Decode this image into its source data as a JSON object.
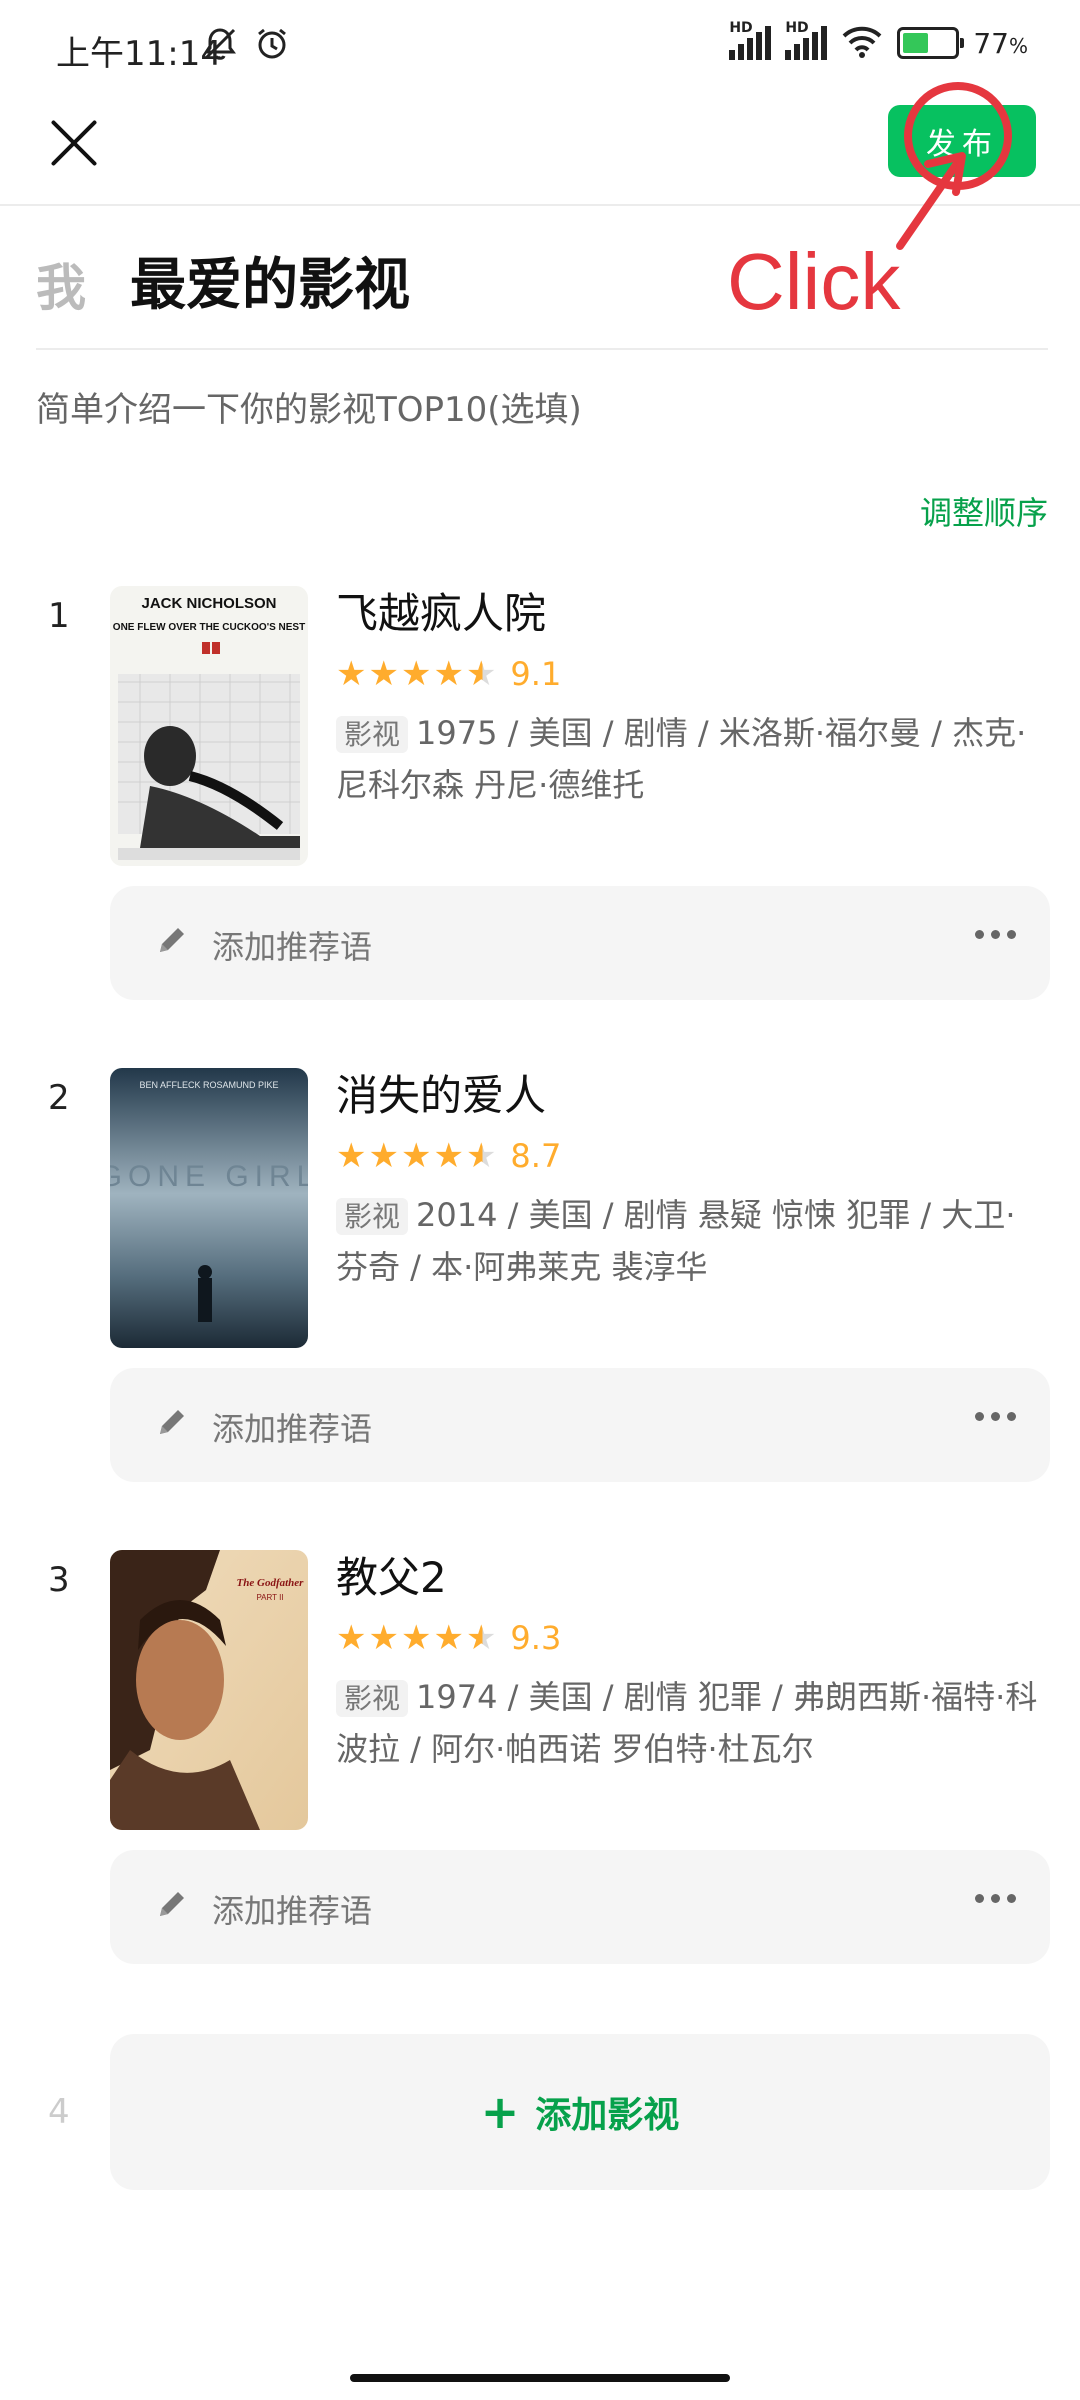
{
  "status_bar": {
    "time": "上午11:14",
    "battery_percent": "77",
    "battery_unit": "%",
    "battery_level": 0.77,
    "hd_label": "HD"
  },
  "header": {
    "close_icon": "close-icon",
    "publish_label": "发布"
  },
  "annotation": {
    "text": "Click",
    "color": "#e5373f"
  },
  "list": {
    "author_label": "我",
    "title": "最爱的影视",
    "intro_placeholder": "简单介绍一下你的影视TOP10(选填)",
    "reorder_label": "调整顺序"
  },
  "items": [
    {
      "num": "1",
      "title": "飞越疯人院",
      "score": "9.1",
      "tag": "影视",
      "meta": "1975 / 美国 / 剧情 / 米洛斯·福尔曼 / 杰克·尼科尔森 丹尼·德维托",
      "note_placeholder": "添加推荐语",
      "poster_text": "JACK NICHOLSON",
      "poster_subtext": "ONE FLEW OVER THE CUCKOO'S NEST"
    },
    {
      "num": "2",
      "title": "消失的爱人",
      "score": "8.7",
      "tag": "影视",
      "meta": "2014 / 美国 / 剧情 悬疑 惊悚 犯罪 / 大卫·芬奇 / 本·阿弗莱克 裴淳华",
      "note_placeholder": "添加推荐语",
      "poster_text": "BEN AFFLECK   ROSAMUND PIKE",
      "poster_subtext": "GONE GIRL"
    },
    {
      "num": "3",
      "title": "教父2",
      "score": "9.3",
      "tag": "影视",
      "meta": "1974 / 美国 / 剧情 犯罪 / 弗朗西斯·福特·科波拉 / 阿尔·帕西诺 罗伯特·杜瓦尔",
      "note_placeholder": "添加推荐语",
      "poster_text": "The Godfather",
      "poster_subtext": "PART II"
    }
  ],
  "add": {
    "num": "4",
    "label": "添加影视"
  },
  "colors": {
    "accent_green": "#07c160",
    "star": "#ffac2d"
  }
}
